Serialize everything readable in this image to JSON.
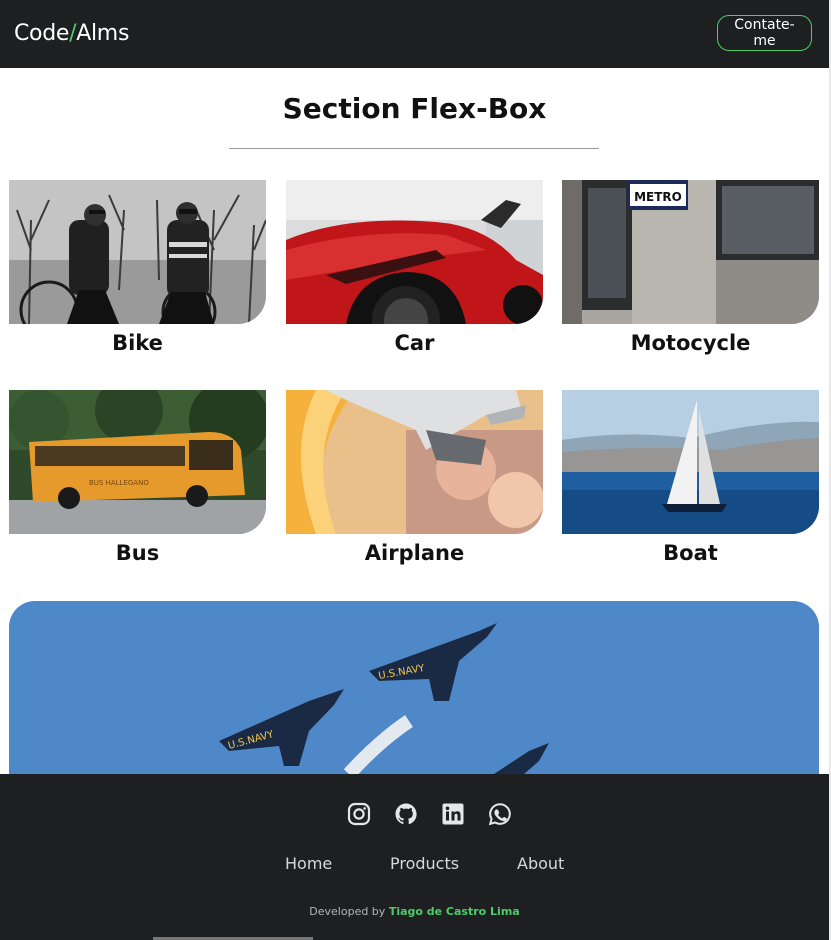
{
  "header": {
    "logo_left": "Code",
    "logo_slash": "/",
    "logo_right": "Alms",
    "contact_label": "Contate-me"
  },
  "section": {
    "title": "Section Flex-Box"
  },
  "cards": [
    {
      "label": "Bike"
    },
    {
      "label": "Car"
    },
    {
      "label": "Motocycle"
    },
    {
      "label": "Bus"
    },
    {
      "label": "Airplane"
    },
    {
      "label": "Boat"
    }
  ],
  "metro_sign": "METRO",
  "bus_sign": "BUS HALLEGANO",
  "jet_text": "U.S.NAVY",
  "footer": {
    "social_icons": [
      "instagram-icon",
      "github-icon",
      "linkedin-icon",
      "whatsapp-icon"
    ],
    "nav": [
      {
        "label": "Home"
      },
      {
        "label": "Products"
      },
      {
        "label": "About"
      }
    ],
    "credit_prefix": "Developed by ",
    "credit_author": "Tiago de Castro Lima"
  },
  "colors": {
    "header_bg": "#1e1f21",
    "accent": "#4ecb6b",
    "footer_bg": "#1e1f21"
  }
}
